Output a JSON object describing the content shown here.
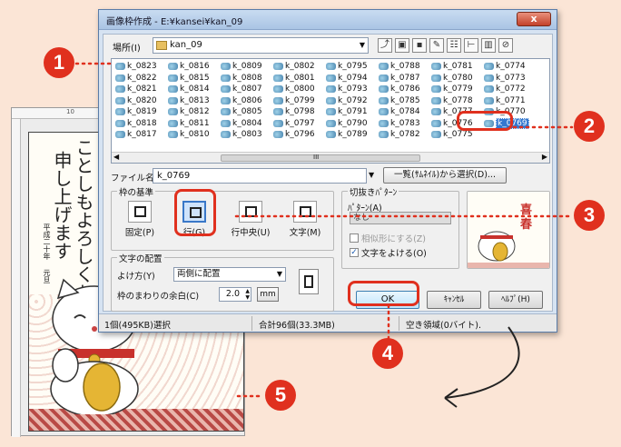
{
  "dialog": {
    "title": "画像枠作成 - E:¥kansei¥kan_09",
    "close_label": "x"
  },
  "location": {
    "label": "場所(I)",
    "value": "kan_09"
  },
  "files": [
    "k_0823",
    "k_0816",
    "k_0809",
    "k_0802",
    "k_0795",
    "k_0788",
    "k_0781",
    "k_0774",
    "k_0822",
    "k_0815",
    "k_0808",
    "k_0801",
    "k_0794",
    "k_0787",
    "k_0780",
    "k_0773",
    "k_0821",
    "k_0814",
    "k_0807",
    "k_0800",
    "k_0793",
    "k_0786",
    "k_0779",
    "k_0772",
    "k_0820",
    "k_0813",
    "k_0806",
    "k_0799",
    "k_0792",
    "k_0785",
    "k_0778",
    "k_0771",
    "k_0819",
    "k_0812",
    "k_0805",
    "k_0798",
    "k_0791",
    "k_0784",
    "k_0777",
    "k_0770",
    "k_0818",
    "k_0811",
    "k_0804",
    "k_0797",
    "k_0790",
    "k_0783",
    "k_0776",
    "k_0769",
    "k_0817",
    "k_0810",
    "k_0803",
    "k_0796",
    "k_0789",
    "k_0782",
    "k_0775",
    ""
  ],
  "selected_file": "k_0769",
  "scroll_mid": "III",
  "filename": {
    "label": "ファイル名(N)",
    "value": "k_0769",
    "pick_button": "一覧(ｻﾑﾈｲﾙ)から選択(D)..."
  },
  "frame_basis": {
    "title": "枠の基準",
    "buttons": [
      "固定(P)",
      "行(G)",
      "行中央(U)",
      "文字(M)"
    ]
  },
  "text_layout": {
    "title": "文字の配置",
    "yoke_label": "よけ方(Y)",
    "yoke_value": "両側に配置",
    "margin_label": "枠のまわりの余白(C)",
    "margin_value": "2.0",
    "unit": "mm"
  },
  "cutout": {
    "title": "切抜きﾊﾟﾀｰﾝ",
    "pattern_label": "ﾊﾟﾀｰﾝ(A)",
    "pattern_value": "なし",
    "chk1": "相似形にする(Z)",
    "chk2": "文字をよける(O)"
  },
  "buttons": {
    "ok": "OK",
    "cancel": "ｷｬﾝｾﾙ",
    "help": "ﾍﾙﾌﾟ(H)"
  },
  "status": {
    "selected": "1個(495KB)選択",
    "total": "合計96個(33.3MB)",
    "free": "空き領域(0バイト)."
  },
  "callouts": [
    "1",
    "2",
    "3",
    "4",
    "5"
  ],
  "document": {
    "ruler_mark": "10",
    "line1": "ことしもよろしくお願い",
    "line2": "申し上げます",
    "date": "平成二十年",
    "date2": "元旦"
  },
  "colors": {
    "accent": "#e0301e",
    "background": "#fbe5d6"
  }
}
